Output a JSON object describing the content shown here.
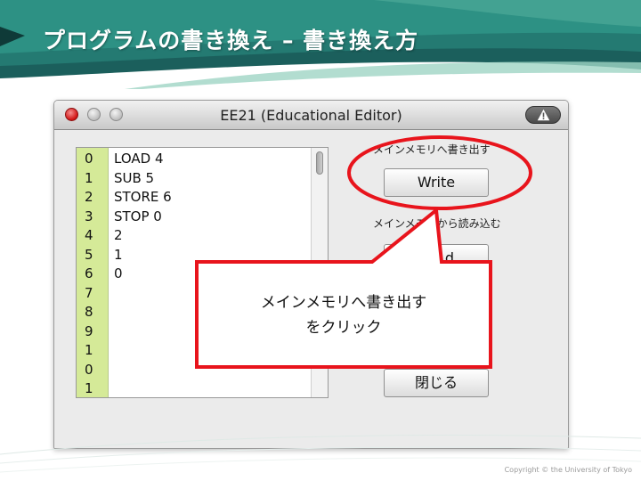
{
  "slide": {
    "title": "プログラムの書き換え – 書き換え方",
    "copyright": "Copyright © the University of Tokyo"
  },
  "window": {
    "title": "EE21 (Educational Editor)"
  },
  "memory": {
    "rows": [
      {
        "addr": "0",
        "value": "LOAD 4"
      },
      {
        "addr": "1",
        "value": "SUB 5"
      },
      {
        "addr": "2",
        "value": "STORE 6"
      },
      {
        "addr": "3",
        "value": "STOP 0"
      },
      {
        "addr": "4",
        "value": "2"
      },
      {
        "addr": "5",
        "value": "1"
      },
      {
        "addr": "6",
        "value": "0"
      },
      {
        "addr": "7",
        "value": ""
      },
      {
        "addr": "8",
        "value": ""
      },
      {
        "addr": "9",
        "value": ""
      },
      {
        "addr": "1",
        "value": ""
      },
      {
        "addr": "0",
        "value": ""
      },
      {
        "addr": "1",
        "value": ""
      }
    ]
  },
  "controls": {
    "write_label": "メインメモリへ書き出す",
    "write_button": "Write",
    "read_label": "メインメモリから読み込む",
    "read_button_partial": "d",
    "close_button": "閉じる"
  },
  "callout": {
    "line1": "メインメモリへ書き出す",
    "line2": "をクリック"
  },
  "colors": {
    "accent_red": "#e8141c",
    "address_column": "#d5ea98",
    "header_teal": "#1f6e6a"
  },
  "icons": {
    "toolbar": "warning-icon"
  }
}
